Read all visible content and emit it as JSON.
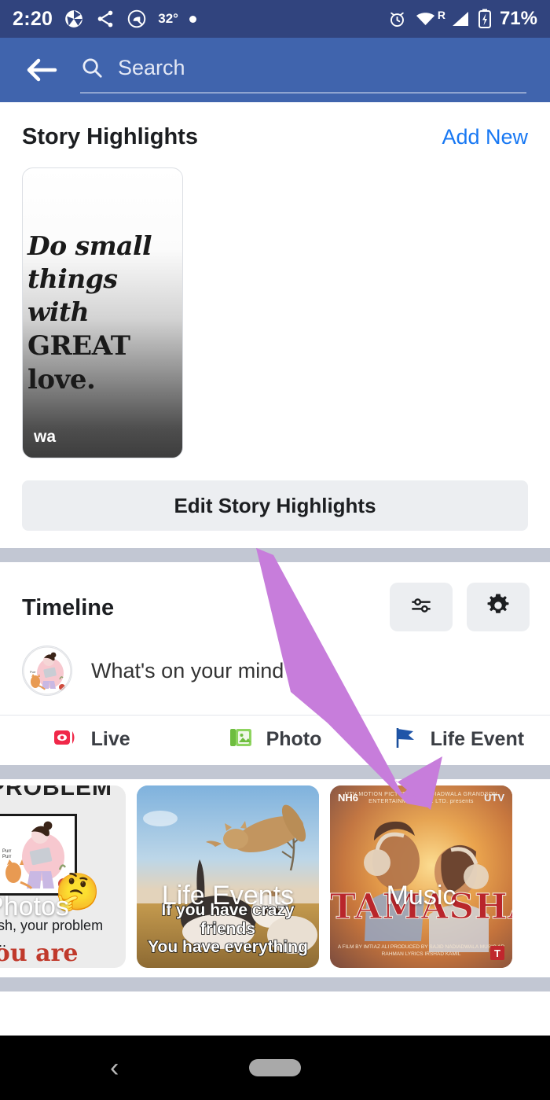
{
  "status_bar": {
    "time": "2:20",
    "temperature": "32°",
    "battery_percent": "71%",
    "icons": [
      "camera-shutter-icon",
      "share-icon",
      "circle-q-icon",
      "dot-icon",
      "alarm-icon",
      "wifi-icon",
      "roaming-r-icon",
      "cell-signal-icon",
      "battery-charging-icon"
    ],
    "roaming_label": "R"
  },
  "app_bar": {
    "back_icon": "back-arrow-icon",
    "search_icon": "search-icon",
    "search_placeholder": "Search",
    "search_value": ""
  },
  "story_highlights": {
    "title": "Story Highlights",
    "add_new_label": "Add New",
    "edit_button_label": "Edit Story Highlights",
    "cards": [
      {
        "quote_line1": "Do small",
        "quote_line2": "things with",
        "quote_line3": "GREAT love.",
        "badge": "wa"
      }
    ]
  },
  "timeline": {
    "title": "Timeline",
    "filter_icon": "sliders-icon",
    "settings_icon": "gear-icon",
    "composer_placeholder": "What's on your mind?",
    "avatar_name": "user-avatar",
    "actions": [
      {
        "label": "Live",
        "icon": "live-video-icon",
        "color": "#f02849"
      },
      {
        "label": "Photo",
        "icon": "photo-icon",
        "color": "#6ebd3f"
      },
      {
        "label": "Life Event",
        "icon": "flag-icon",
        "color": "#1b4f9c"
      }
    ]
  },
  "photo_strip": {
    "cards": [
      {
        "overlay_label": "Photos",
        "top_text": "PROBLEM",
        "caption": "wish, your problem is...",
        "red_text": "You are",
        "emoji": "🤔"
      },
      {
        "overlay_label": "Life Events",
        "meme_line1": "If you have crazy friends",
        "meme_line2": "You have everything"
      },
      {
        "overlay_label": "Music",
        "poster_title": "TAMASHA",
        "poster_top": "UTV MOTION PICTURES & NADIADWALA GRANDSON ENTERTAINMENT PVT. LTD. presents",
        "poster_nh": "NH6",
        "poster_utv": "UTV",
        "poster_credits": "A FILM BY IMTIAZ ALI\nPRODUCED BY SAJID NADIADWALA  MUSIC AR RAHMAN\nLYRICS IRSHAD KAMIL",
        "tseries": "T"
      }
    ]
  },
  "annotation": {
    "arrow_color": "#c77ddb",
    "arrow_name": "callout-arrow"
  },
  "nav_bar": {
    "back_label": "‹",
    "home_pill": "home-pill"
  }
}
